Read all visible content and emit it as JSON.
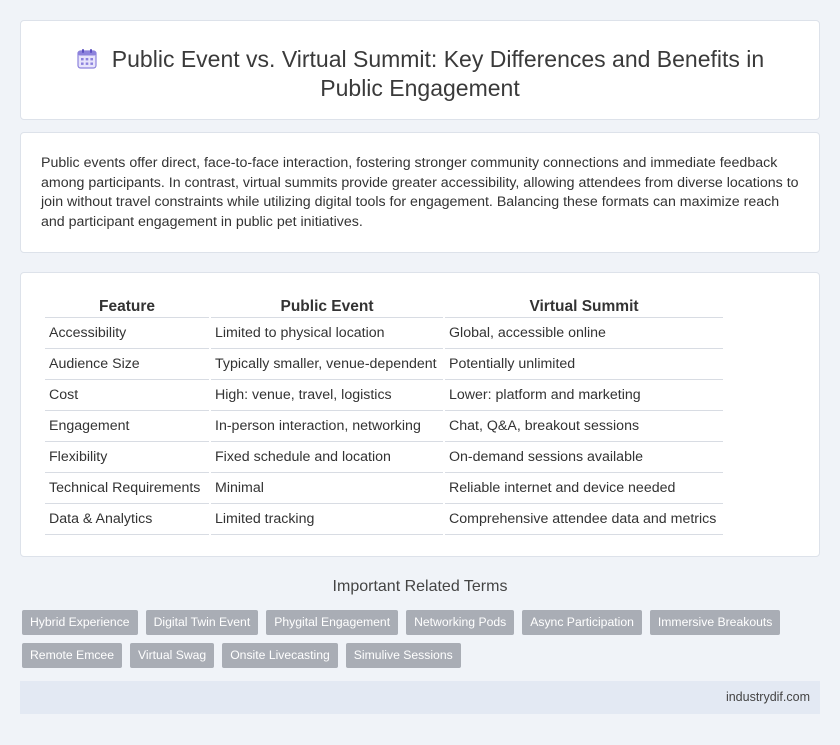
{
  "page": {
    "title": "Public Event vs. Virtual Summit: Key Differences and Benefits in Public Engagement",
    "title_icon": "calendar-icon",
    "intro": "Public events offer direct, face-to-face interaction, fostering stronger community connections and immediate feedback among participants. In contrast, virtual summits provide greater accessibility, allowing attendees from diverse locations to join without travel constraints while utilizing digital tools for engagement. Balancing these formats can maximize reach and participant engagement in public pet initiatives."
  },
  "table": {
    "headers": [
      "Feature",
      "Public Event",
      "Virtual Summit"
    ],
    "rows": [
      [
        "Accessibility",
        "Limited to physical location",
        "Global, accessible online"
      ],
      [
        "Audience Size",
        "Typically smaller, venue-dependent",
        "Potentially unlimited"
      ],
      [
        "Cost",
        "High: venue, travel, logistics",
        "Lower: platform and marketing"
      ],
      [
        "Engagement",
        "In-person interaction, networking",
        "Chat, Q&A, breakout sessions"
      ],
      [
        "Flexibility",
        "Fixed schedule and location",
        "On-demand sessions available"
      ],
      [
        "Technical Requirements",
        "Minimal",
        "Reliable internet and device needed"
      ],
      [
        "Data & Analytics",
        "Limited tracking",
        "Comprehensive attendee data and metrics"
      ]
    ]
  },
  "related": {
    "title": "Important Related Terms",
    "tags": [
      "Hybrid Experience",
      "Digital Twin Event",
      "Phygital Engagement",
      "Networking Pods",
      "Async Participation",
      "Immersive Breakouts",
      "Remote Emcee",
      "Virtual Swag",
      "Onsite Livecasting",
      "Simulive Sessions"
    ]
  },
  "footer": {
    "site": "industrydif.com"
  },
  "colors": {
    "background": "#f0f3f8",
    "tag_bg": "#a9adb5",
    "footer_bg": "#e3e9f3",
    "icon_accent": "#7b6fd6"
  }
}
